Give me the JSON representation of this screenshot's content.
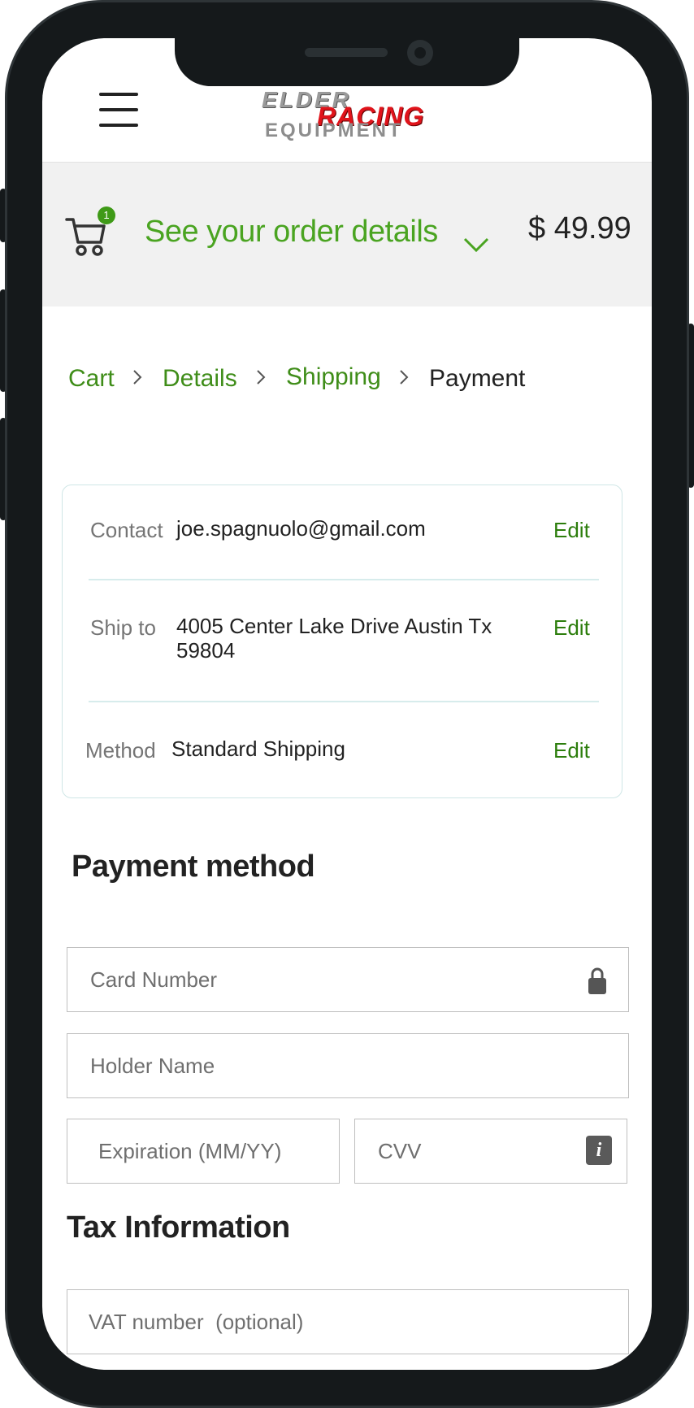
{
  "header": {
    "logo": {
      "line1": "ELDER",
      "line2": "RACING",
      "line3": "EQUIPMENT"
    }
  },
  "summary": {
    "cart_count": "1",
    "toggle_label": "See  your order details",
    "total": "$ 49.99"
  },
  "breadcrumb": {
    "items": [
      {
        "label": "Cart"
      },
      {
        "label": "Details"
      },
      {
        "label": "Shipping"
      },
      {
        "label": "Payment"
      }
    ]
  },
  "review": {
    "contact": {
      "label": "Contact",
      "value": "joe.spagnuolo@gmail.com",
      "edit": "Edit"
    },
    "ship_to": {
      "label": "Ship to",
      "value_line1": "4005 Center Lake Drive Austin Tx",
      "value_line2": "59804",
      "edit": "Edit"
    },
    "method": {
      "label": "Method",
      "value": "Standard Shipping",
      "edit": "Edit"
    }
  },
  "payment": {
    "title": "Payment method",
    "card_number_placeholder": "Card Number",
    "holder_name_placeholder": "Holder Name",
    "expiration_placeholder": "Expiration (MM/YY)",
    "cvv_placeholder": "CVV"
  },
  "tax": {
    "title": "Tax Information",
    "vat_placeholder": "VAT number  (optional)"
  },
  "colors": {
    "accent_green": "#4aa421",
    "edit_green": "#2c7d0c",
    "badge_green": "#3f9a17",
    "frame": "#15191b"
  }
}
